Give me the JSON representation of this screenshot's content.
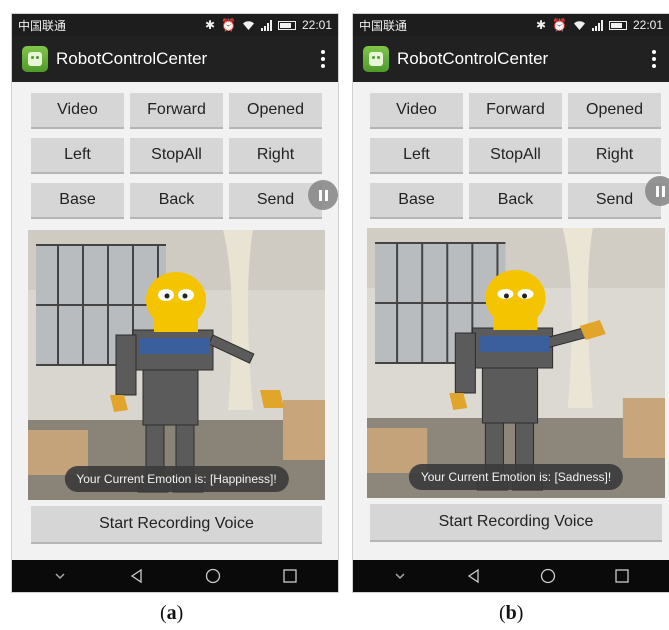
{
  "panels": [
    {
      "status": {
        "carrier": "中国联通",
        "time": "22:01"
      },
      "app_title": "RobotControlCenter",
      "buttons": [
        "Video",
        "Forward",
        "Opened",
        "Left",
        "StopAll",
        "Right",
        "Base",
        "Back",
        "Send"
      ],
      "toast": "Your Current Emotion is: [Happiness]!",
      "record_label": "Start Recording Voice",
      "caption": "a"
    },
    {
      "status": {
        "carrier": "中国联通",
        "time": "22:01"
      },
      "app_title": "RobotControlCenter",
      "buttons": [
        "Video",
        "Forward",
        "Opened",
        "Left",
        "StopAll",
        "Right",
        "Base",
        "Back",
        "Send"
      ],
      "toast": "Your Current Emotion is: [Sadness]!",
      "record_label": "Start Recording Voice",
      "caption": "b"
    }
  ],
  "icons": {
    "status": [
      "bluetooth-icon",
      "alarm-icon",
      "wifi-icon",
      "signal-icon",
      "battery-icon"
    ],
    "appbar": [
      "app-robot-icon",
      "overflow-menu-icon"
    ],
    "navbar": [
      "chevron-down-icon",
      "back-icon",
      "home-icon",
      "recents-icon"
    ],
    "overlay": [
      "pause-icon"
    ]
  },
  "colors": {
    "statusbar": "#1d1d1d",
    "appbar": "#212121",
    "background": "#f2f2f2",
    "button": "#d6d6d6",
    "toast": "#3c3c3c",
    "navbar": "#0a0a0a",
    "robot_head": "#f5c400"
  }
}
